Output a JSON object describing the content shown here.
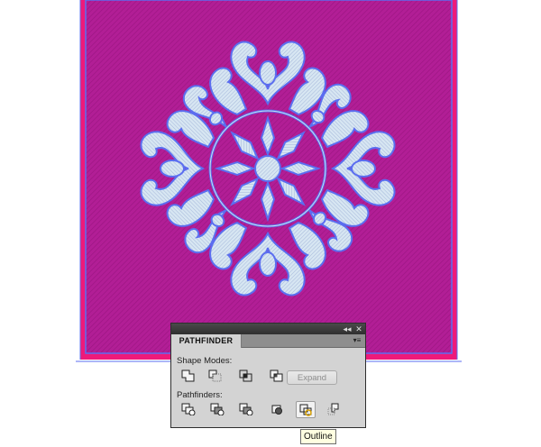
{
  "panel": {
    "tab_label": "PATHFINDER",
    "collapse_glyph": "◂◂",
    "close_glyph": "✕",
    "menu_glyph": "▾≡",
    "shape_modes_label": "Shape Modes:",
    "expand_label": "Expand",
    "pathfinders_label": "Pathfinders:",
    "shape_mode_buttons": [
      "unite",
      "minus-front",
      "intersect",
      "exclude"
    ],
    "pathfinder_buttons": [
      "divide",
      "trim",
      "merge",
      "crop",
      "outline",
      "minus-back"
    ],
    "hovered_button": "outline"
  },
  "tooltip": {
    "text": "Outline"
  },
  "colors": {
    "artboard_fill": "#b8198f",
    "frame_pink": "#ee1a7a",
    "selection_blue": "#5b6ef0",
    "ornament": "#c8e0ee"
  }
}
